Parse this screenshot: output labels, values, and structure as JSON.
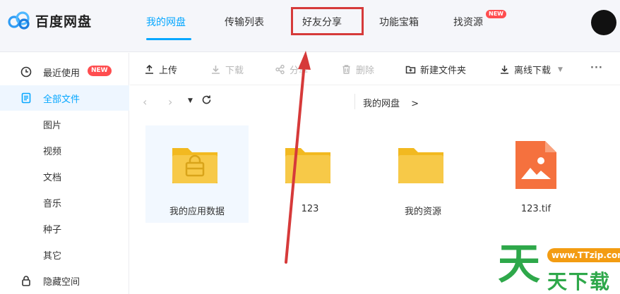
{
  "app": {
    "title": "百度网盘"
  },
  "nav": {
    "tabs": [
      {
        "label": "我的网盘"
      },
      {
        "label": "传输列表"
      },
      {
        "label": "好友分享"
      },
      {
        "label": "功能宝箱"
      },
      {
        "label": "找资源"
      }
    ],
    "new_badge": "NEW",
    "active_color": "#06a7ff"
  },
  "sidebar": {
    "items": [
      {
        "label": "最近使用",
        "icon": "clock-icon",
        "badge": "NEW"
      },
      {
        "label": "全部文件",
        "icon": "document-icon"
      },
      {
        "label": "图片"
      },
      {
        "label": "视频"
      },
      {
        "label": "文档"
      },
      {
        "label": "音乐"
      },
      {
        "label": "种子"
      },
      {
        "label": "其它"
      },
      {
        "label": "隐藏空间",
        "icon": "lock-icon"
      }
    ]
  },
  "toolbar": {
    "upload": "上传",
    "download": "下载",
    "share": "分享",
    "delete": "删除",
    "new_folder": "新建文件夹",
    "offline_download": "离线下载",
    "more": "···"
  },
  "breadcrumb": {
    "path": "我的网盘",
    "separator": ">"
  },
  "files": [
    {
      "name": "我的应用数据",
      "type": "app-folder"
    },
    {
      "name": "123",
      "type": "folder"
    },
    {
      "name": "我的资源",
      "type": "folder"
    },
    {
      "name": "123.tif",
      "type": "image"
    }
  ],
  "watermark": {
    "url": "www.TTzip.com",
    "big": "天",
    "small": "天下载"
  },
  "colors": {
    "highlight": "#d63a3a",
    "folder": "#f7c948",
    "image_file": "#f5713e"
  }
}
